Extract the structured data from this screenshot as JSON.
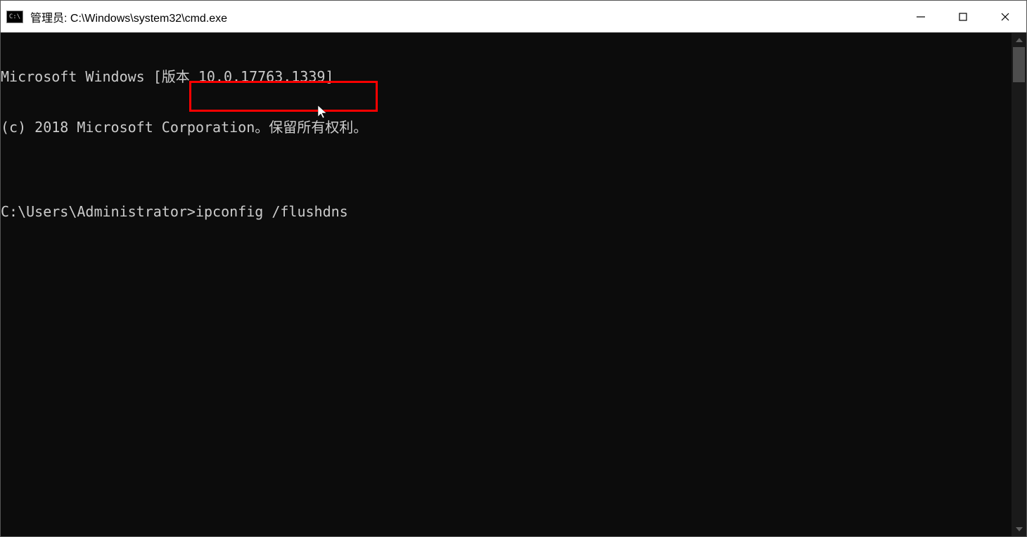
{
  "titlebar": {
    "icon_label": "C:\\",
    "title": "管理员: C:\\Windows\\system32\\cmd.exe"
  },
  "terminal": {
    "line1": "Microsoft Windows [版本 10.0.17763.1339]",
    "line2": "(c) 2018 Microsoft Corporation。保留所有权利。",
    "blank": "",
    "prompt": "C:\\Users\\Administrator>",
    "command": "ipconfig /flushdns"
  },
  "highlight": {
    "color": "#ff0000"
  }
}
